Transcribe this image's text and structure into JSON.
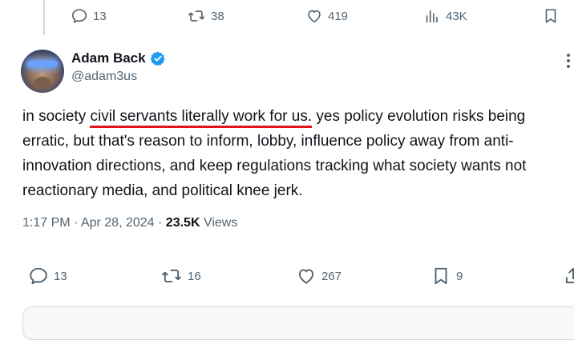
{
  "previous_tweet": {
    "replies": "13",
    "reposts": "38",
    "likes": "419",
    "views": "43K"
  },
  "tweet": {
    "author": {
      "display_name": "Adam Back",
      "handle": "@adam3us",
      "verified": true
    },
    "text_before": "in society ",
    "text_highlight": "civil servants literally work for us.",
    "text_after": " yes policy evolution risks being erratic, but that's reason to inform, lobby, influence policy away from anti-innovation directions, and keep regulations tracking what society wants not reactionary media, and political knee jerk.",
    "time": "1:17 PM",
    "separator": "·",
    "date": "Apr 28, 2024",
    "views_count": "23.5K",
    "views_label": "Views",
    "replies": "13",
    "reposts": "16",
    "likes": "267",
    "bookmarks": "9"
  },
  "colors": {
    "verified_badge": "#1d9bf0",
    "underline": "#e0141b",
    "secondary_text": "#536471"
  },
  "icons": [
    "reply-icon",
    "repost-icon",
    "like-icon",
    "views-icon",
    "bookmark-icon",
    "share-icon",
    "verified-badge-icon",
    "more-icon"
  ]
}
